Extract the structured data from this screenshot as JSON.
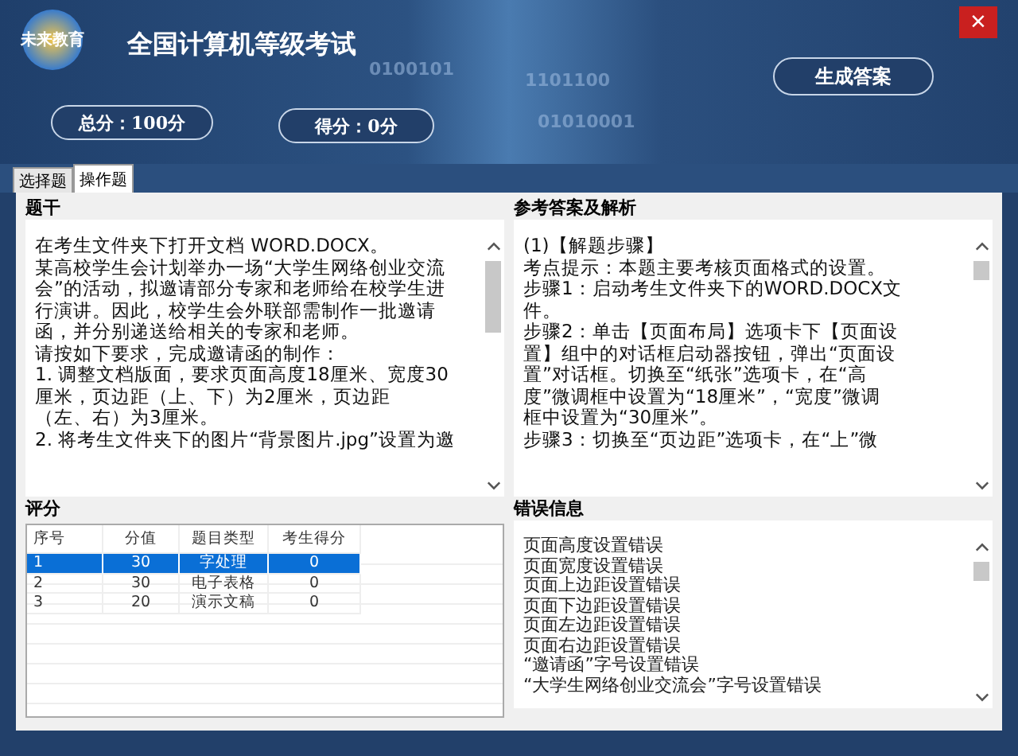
{
  "header": {
    "logo_text": "未来教育",
    "title": "全国计算机等级考试",
    "background_texts": [
      "0100101",
      "1101100",
      "01010001"
    ],
    "total_score": "总分：100分",
    "score": "得分：0分",
    "generate_button": "生成答案",
    "close": "×"
  },
  "tabs": [
    {
      "label": "选择题",
      "selected": false
    },
    {
      "label": "操作题",
      "selected": true
    }
  ],
  "question": {
    "heading": "题干",
    "lines": [
      "在考生文件夹下打开文档 WORD.DOCX。",
      "某高校学生会计划举办一场“大学生网络创业交流",
      "会”的活动，拟邀请部分专家和老师给在校学生进",
      "行演讲。因此，校学生会外联部需制作一批邀请",
      "函，并分别递送给相关的专家和老师。",
      "请按如下要求，完成邀请函的制作：",
      "1. 调整文档版面，要求页面高度18厘米、宽度30",
      "厘米，页边距（上、下）为2厘米，页边距",
      "（左、右）为3厘米。",
      "2. 将考生文件夹下的图片“背景图片.jpg”设置为邀"
    ]
  },
  "answer": {
    "heading": "参考答案及解析",
    "lines": [
      "(1)【解题步骤】",
      "考点提示：本题主要考核页面格式的设置。",
      "步骤1：启动考生文件夹下的WORD.DOCX文",
      "件。",
      "步骤2：单击【页面布局】选项卡下【页面设",
      "置】组中的对话框启动器按钮，弹出“页面设",
      "置”对话框。切换至“纸张”选项卡，在“高",
      "度”微调框中设置为“18厘米”，“宽度”微调",
      "框中设置为“30厘米”。",
      "步骤3：切换至“页边距”选项卡，在“上”微"
    ]
  },
  "scoring": {
    "heading": "评分",
    "columns": [
      "序号",
      "分值",
      "题目类型",
      "考生得分"
    ],
    "rows": [
      {
        "cells": [
          "1",
          "30",
          "字处理",
          "0"
        ],
        "selected": true
      },
      {
        "cells": [
          "2",
          "30",
          "电子表格",
          "0"
        ],
        "selected": false
      },
      {
        "cells": [
          "3",
          "20",
          "演示文稿",
          "0"
        ],
        "selected": false
      }
    ]
  },
  "errors": {
    "heading": "错误信息",
    "lines": [
      "页面高度设置错误",
      "页面宽度设置错误",
      "页面上边距设置错误",
      "页面下边距设置错误",
      "页面左边距设置错误",
      "页面右边距设置错误",
      "“邀请函”字号设置错误",
      "“大学生网络创业交流会”字号设置错误"
    ]
  }
}
